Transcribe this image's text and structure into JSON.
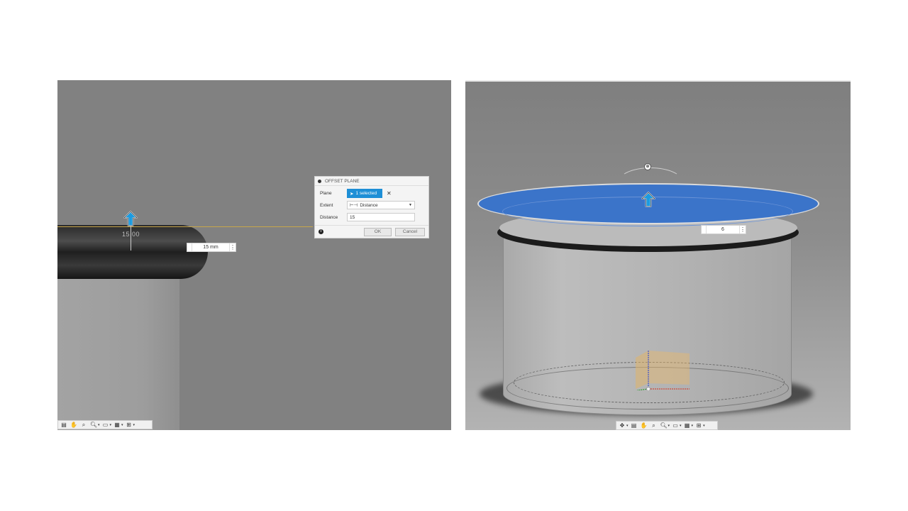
{
  "left": {
    "dimension_label": "15.00",
    "inline_value": "15 mm",
    "dialog": {
      "title": "OFFSET PLANE",
      "plane_label": "Plane",
      "plane_value": "1 selected",
      "extent_label": "Extent",
      "extent_value": "Distance",
      "distance_label": "Distance",
      "distance_value": "15",
      "ok": "OK",
      "cancel": "Cancel"
    }
  },
  "right": {
    "inline_value": "6"
  },
  "colors": {
    "accent_blue": "#1e8fd6",
    "plane_blue": "#3b74c9",
    "plane_line": "#c8a64a"
  }
}
